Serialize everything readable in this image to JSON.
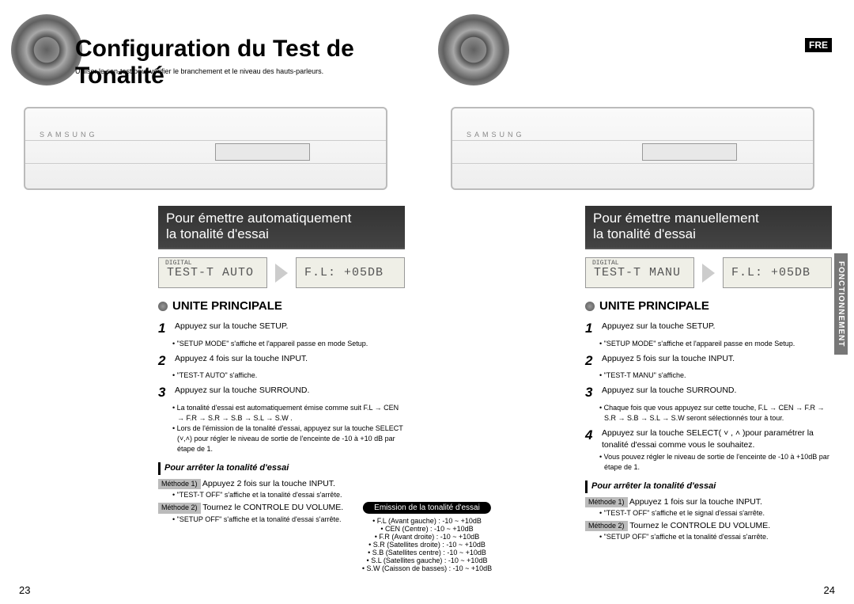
{
  "lang_badge": "FRE",
  "side_tab": "FONCTIONNEMENT",
  "title": "Configuration du Test de Tonalité",
  "subtitle": "Utiliser le son-test pour vérifier le branchement et le niveau des hauts-parleurs.",
  "brand": "SAMSUNG",
  "pagenum_left": "23",
  "pagenum_right": "24",
  "emission": {
    "header": "Emission de la tonalité d'essai",
    "lines": [
      "• F.L (Avant gauche) : -10 ~ +10dB",
      "• CEN (Centre) : -10 ~ +10dB",
      "• F.R (Avant droite) : -10 ~ +10dB",
      "• S.R (Satellites droite) : -10 ~ +10dB",
      "• S.B (Satellites centre) : -10 ~ +10dB",
      "• S.L (Satellites gauche) : -10 ~ +10dB",
      "• S.W (Caisson de basses) : -10 ~ +10dB"
    ]
  },
  "left": {
    "banner_l1": "Pour émettre automatiquement",
    "banner_l2": "la tonalité d'essai",
    "lcd1_tag": "DIGITAL",
    "lcd1": "TEST-T AUTO",
    "lcd2": "F.L: +05DB",
    "unite": "UNITE PRINCIPALE",
    "s1": "Appuyez sur la touche SETUP.",
    "s1n": "• \"SETUP MODE\" s'affiche et l'appareil passe en mode Setup.",
    "s2": "Appuyez 4 fois sur la touche INPUT.",
    "s2n": "• \"TEST-T AUTO\" s'affiche.",
    "s3": "Appuyez sur la touche SURROUND.",
    "s3n1": "• La tonalité d'essai est automatiquement émise comme suit F.L → CEN → F.R → S.R → S.B → S.L → S.W .",
    "s3n2": "• Lors de l'émission de la tonalité d'essai, appuyez sur la touche SELECT (˅,˄) pour régler le niveau de sortie de l'enceinte de -10 à +10 dB par étape de 1.",
    "stop_h": "Pour arrêter la tonalité d'essai",
    "m1label": "Méthode 1)",
    "m1": " Appuyez 2 fois sur la touche INPUT.",
    "m1n": "• \"TEST-T OFF\" s'affiche et la tonalité d'essai s'arrête.",
    "m2label": "Méthode 2)",
    "m2": " Tournez le CONTROLE DU VOLUME.",
    "m2n": "• \"SETUP OFF\" s'affiche et la tonalité d'essai s'arrête."
  },
  "right": {
    "banner_l1": "Pour émettre manuellement",
    "banner_l2": "la tonalité d'essai",
    "lcd1_tag": "DIGITAL",
    "lcd1": "TEST-T MANU",
    "lcd2": "F.L: +05DB",
    "unite": "UNITE PRINCIPALE",
    "s1": "Appuyez sur la touche SETUP.",
    "s1n": "• \"SETUP MODE\" s'affiche et l'appareil passe en mode Setup.",
    "s2": "Appuyez 5 fois sur la touche INPUT.",
    "s2n": "• \"TEST-T MANU\" s'affiche.",
    "s3": "Appuyez sur la touche SURROUND.",
    "s3n": "• Chaque fois que vous appuyez sur cette touche, F.L → CEN → F.R → S.R → S.B → S.L → S.W seront sélectionnés tour à tour.",
    "s4": "Appuyez sur la touche SELECT( ˅ , ˄ )pour paramétrer la tonalité d'essai comme vous le souhaitez.",
    "s4n": "• Vous pouvez régler le niveau de sortie de l'enceinte de -10 à +10dB par étape de 1.",
    "stop_h": "Pour arrêter la tonalité d'essai",
    "m1label": "Méthode 1)",
    "m1": " Appuyez 1 fois sur la touche INPUT.",
    "m1n": "• \"TEST-T OFF\" s'affiche et le signal d'essai s'arrête.",
    "m2label": "Méthode 2)",
    "m2": " Tournez le CONTROLE DU VOLUME.",
    "m2n": "• \"SETUP OFF\" s'affiche et la tonalité d'essai s'arrête."
  }
}
